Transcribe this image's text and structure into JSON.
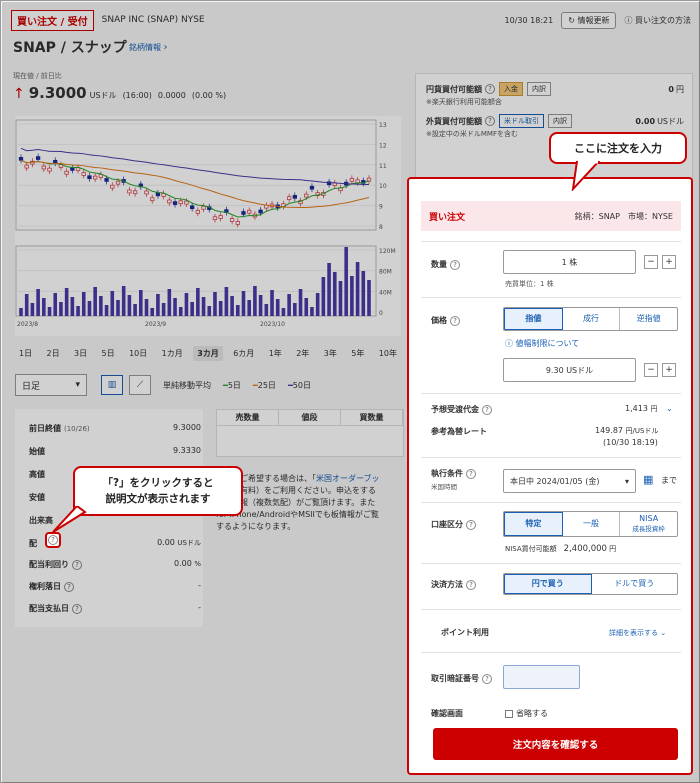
{
  "header": {
    "tag": "買い注文 / 受付",
    "company": "SNAP INC (SNAP) NYSE",
    "datetime": "10/30 18:21",
    "refresh_label": "情報更新",
    "orders_link": "買い注文の方法"
  },
  "stock": {
    "title": "SNAP / スナップ",
    "info_link": "銘柄情報",
    "prev_label": "現在値 / 前日比",
    "price": "9.3000",
    "unit": "USドル",
    "time": "(16:00)",
    "change": "0.0000",
    "change_pct": "(0.00 %)"
  },
  "chart_data": {
    "type": "line",
    "x_labels": [
      "2023/8",
      "2023/9",
      "2023/10"
    ],
    "price_axis": [
      "13",
      "12",
      "11",
      "10",
      "9",
      "8"
    ],
    "volume_axis": [
      "120M",
      "80M",
      "40M",
      "0"
    ],
    "legend": [
      "5日",
      "25日",
      "50日"
    ],
    "colors": {
      "ma5": "#2aa12a",
      "ma25": "#e07a1a",
      "ma50": "#4a3aa8",
      "up": "#d8333a",
      "down": "#1a2a9a"
    }
  },
  "periods": [
    {
      "label": "1日",
      "active": false
    },
    {
      "label": "2日",
      "active": false
    },
    {
      "label": "3日",
      "active": false
    },
    {
      "label": "5日",
      "active": false
    },
    {
      "label": "10日",
      "active": false
    },
    {
      "label": "1カ月",
      "active": false
    },
    {
      "label": "3カ月",
      "active": true
    },
    {
      "label": "6カ月",
      "active": false
    },
    {
      "label": "1年",
      "active": false
    },
    {
      "label": "2年",
      "active": false
    },
    {
      "label": "3年",
      "active": false
    },
    {
      "label": "5年",
      "active": false
    },
    {
      "label": "10年",
      "active": false
    }
  ],
  "controls": {
    "interval": "日足",
    "ma_label": "単純移動平均",
    "ma5": "5日",
    "ma25": "25日",
    "ma50": "50日"
  },
  "info_table": {
    "prev_close_label": "前日終値",
    "prev_close_date": "(10/26)",
    "prev_close": "9.3000",
    "open_label": "始値",
    "open": "9.3330",
    "high_label": "高値",
    "low_label": "安値",
    "volume_label": "出来高",
    "dividend_label": "配",
    "dividend": "0.00",
    "dividend_unit": "USドル",
    "yield_label": "配当利回り",
    "yield": "0.00",
    "yield_unit": "%",
    "rights_label": "権利落日",
    "rights": "-",
    "paydate_label": "配当支払日",
    "paydate": "-"
  },
  "board": {
    "h1": "売数量",
    "h2": "値段",
    "h3": "買数量",
    "note_a": "表示をご希望する場合は、「",
    "note_link1": "米国オーダーブッ",
    "note_b": "報）",
    "note_c": "」（有料）をご利用ください。申込をする",
    "note_d": "で板情報（複数気配）がご覧頂けます。また",
    "note_e": "for iPhone/Android",
    "note_f": "やMSIIでも板情報がご覧",
    "note_g": "するようになります。"
  },
  "summary": {
    "yen_label": "円貨買付可能額",
    "yen_btn1": "入金",
    "yen_btn2": "内訳",
    "yen_value": "0",
    "yen_unit": "円",
    "yen_note": "※楽天銀行利用可能額含",
    "fx_label": "外貨買付可能額",
    "fx_btn1": "米ドル取引",
    "fx_btn2": "内訳",
    "fx_value": "0.00",
    "fx_unit": "USドル",
    "fx_note": "※設定中の米ドルMMFを含む"
  },
  "order": {
    "head_label": "買い注文",
    "head_meta": "銘柄：SNAP　市場：NYSE",
    "qty_label": "数量",
    "qty_value": "1 株",
    "qty_unit_note": "売買単位：1 株",
    "price_label": "価格",
    "price_types": [
      "指値",
      "成行",
      "逆指値"
    ],
    "price_limit_link": "値幅制限について",
    "price_value": "9.30 USドル",
    "est_label": "予想受渡代金",
    "est_value": "1,413",
    "est_unit": "円",
    "rate_label": "参考為替レート",
    "rate_value": "149.87",
    "rate_unit": "円/USドル",
    "rate_time": "(10/30  18:19)",
    "cond_label": "執行条件",
    "cond_sub": "米国時間",
    "cond_value": "本日中 2024/01/05 (金)",
    "cond_until": "まで",
    "acct_label": "口座区分",
    "acct_types": [
      "特定",
      "一般",
      "NISA"
    ],
    "acct_nisa_sub": "成長投資枠",
    "nisa_label": "NISA買付可能額",
    "nisa_value": "2,400,000",
    "nisa_unit": "円",
    "settle_label": "決済方法",
    "settle_types": [
      "円で買う",
      "ドルで買う"
    ],
    "points_label": "ポイント利用",
    "points_link": "詳細を表示する",
    "pin_label": "取引暗証番号",
    "confirm_label": "確認画面",
    "skip_label": "省略する",
    "submit_label": "注文内容を確認する"
  },
  "callouts": {
    "top": "ここに注文を入力",
    "left_line1": "「?」をクリックすると",
    "left_line2": "説明文が表示されます"
  }
}
